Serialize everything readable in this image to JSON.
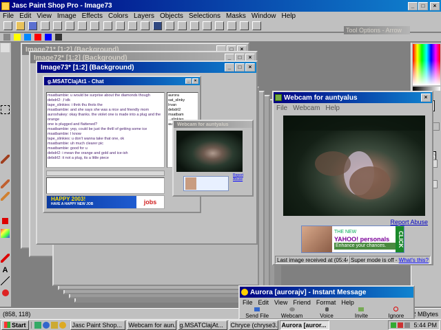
{
  "app": {
    "title": "Jasc Paint Shop Pro - Image73",
    "menu": [
      "File",
      "Edit",
      "View",
      "Image",
      "Effects",
      "Colors",
      "Layers",
      "Objects",
      "Selections",
      "Masks",
      "Window",
      "Help"
    ],
    "tool_options_title": "Tool Options - Arrow",
    "status_coords": "(858, 118)",
    "status_mem": "2.2 MBytes"
  },
  "image_windows": [
    {
      "title": "Image71* [1:2] (Background)"
    },
    {
      "title": "Image72* [1:2] (Background)"
    },
    {
      "title": "Image73* [1:2] (Background)"
    }
  ],
  "chat_window": {
    "title": "g.MSATClajAt1 - Chat",
    "lines": [
      "msatbambie: u would be surprise about the diamonds though",
      "debdrl2: ,f  idk",
      "tape_slinkies: i thnk thu thots the",
      "msatbambie: and she says she was a nice and friendly mom",
      "auroshakey: okay thanks. the violet one is made into a plug and the orange",
      "  one is plugged and flattened?",
      "msatbambie: yep, could be just the thrill of getting some ice",
      "msatbambie: I know",
      "tape_slinkies: u don't wanna take that one, ok",
      "msatbambie: uh much clearer pic",
      "msatbambie: good for u",
      "debdrl2: i mean the orange and gold and ice-ish",
      "debdrl2: it not a plug, its a little piece"
    ],
    "users": [
      "aurora",
      "sat_slinky",
      "Irvan",
      "debdrl2",
      "msatbam",
      "...slinkies",
      "auroshak"
    ]
  },
  "webcam_small": {
    "title": "Webcam for auntyalus",
    "link": "Report Abuse"
  },
  "webcam_main": {
    "title": "Webcam for auntyalus",
    "menu": [
      "File",
      "Webcam",
      "Help"
    ],
    "report_link": "Report Abuse",
    "ad_line1": "THE NEW",
    "ad_brand": "YAHOO! personals",
    "ad_line2": "Enhance your chances.",
    "ad_click": "CLICK",
    "status_left": "Last image received at (05:44:45 PM)",
    "status_mode": "Super mode is off -",
    "status_link": "What's this?"
  },
  "im_window": {
    "title": "Aurora [aurorajv] - Instant Message",
    "menu": [
      "File",
      "Edit",
      "View",
      "Friend",
      "Format",
      "Help"
    ],
    "buttons": [
      "Send File",
      "Webcam",
      "Voice",
      "Invite",
      "Ignore"
    ]
  },
  "banner": {
    "text1": "HAPPY 2003!",
    "text2": "HAVE A HAPPY NEW JOB",
    "logo": "jobs"
  },
  "taskbar": {
    "start": "Start",
    "tasks": [
      "Jasc Paint Shop...",
      "Webcam for aun...",
      "g.MSATClajAt...",
      "Chryce (chryse3...",
      "Aurora [auror..."
    ],
    "clock": "5:44 PM"
  },
  "colors": {
    "title_active": "#000080",
    "title_inactive": "#808080",
    "desktop": "#808080",
    "face": "#c0c0c0"
  }
}
